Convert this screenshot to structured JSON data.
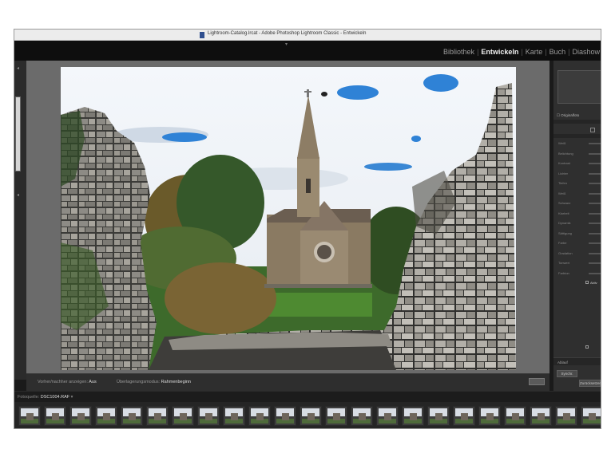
{
  "window": {
    "title": "Lightroom-Catalog.lrcat - Adobe Photoshop Lightroom Classic - Entwickeln"
  },
  "modules": {
    "items": [
      "Bibliothek",
      "Entwickeln",
      "Karte",
      "Buch",
      "Diashow"
    ],
    "active": "Entwickeln"
  },
  "toolbar": {
    "before_after_label": "Vorher/nachher anzeigen:",
    "before_after_value": "Aus",
    "overlay_label": "Überlagerungsmodus:",
    "overlay_value": "Rahmenbeginn"
  },
  "right_panel": {
    "original_label": "Originalfoto",
    "labels": [
      "Weiß",
      "Belichtung",
      "Kontrast",
      "Lichter",
      "Tiefen",
      "Weiß",
      "Schwarz",
      "Klarheit",
      "Dynamik",
      "Sättigung",
      "Farbe",
      "Gradation",
      "Tonwert",
      "Farbton"
    ],
    "check_label": "Aktiv",
    "sync_header": "Ablauf",
    "sync_button": "Synchr.",
    "reset_button": "Zurücksetzen"
  },
  "filmstrip": {
    "label": "Fotoquelle:",
    "folder": "DSC1004.RAF",
    "thumb_count": 24
  },
  "colors": {
    "accent": "#f0f0f0",
    "panel": "#2f2f2f",
    "canvas": "#6b6b6b",
    "sky_blue": "#2f82d6"
  }
}
